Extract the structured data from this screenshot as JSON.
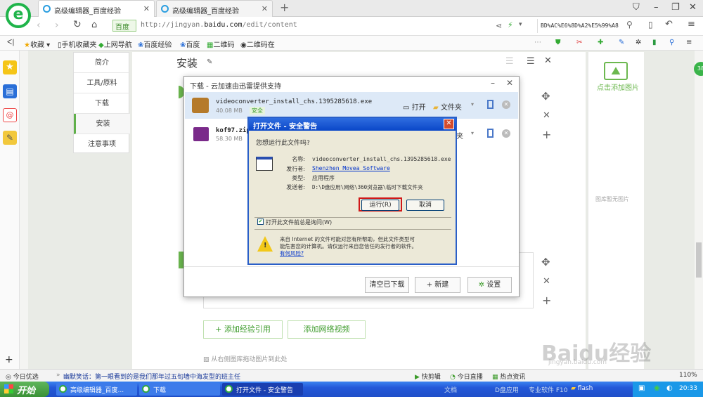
{
  "browser": {
    "tabs": [
      {
        "label": "高级编辑器_百度经验"
      },
      {
        "label": "高级编辑器_百度经验"
      }
    ],
    "new_tab": "+",
    "url_prefix": "http://jingyan.",
    "url_domain": "baidu.com",
    "url_path": "/edit/content",
    "site_badge": "百度",
    "search_text": "BD%AC%E6%8D%A2%E5%99%A8",
    "bookmarks": [
      "收藏",
      "手机收藏夹",
      "上网导航",
      "百度经验",
      "百度",
      "二维码",
      "二维码在"
    ]
  },
  "page": {
    "nav_items": [
      "简介",
      "工具/原料",
      "下载",
      "安装",
      "注意事项"
    ],
    "selected_nav": 3,
    "section_title": "安装",
    "cite_button": "+ 添加经验引用",
    "video_button": "添加网络视频",
    "drag_hint": "从右侧图库拖动图片到此处",
    "right_add_image": "点击添加图片",
    "right_no_image": "图库暂无图片"
  },
  "download_manager": {
    "title": "下载 - 云加速由迅雷提供支持",
    "items": [
      {
        "name": "videoconverter_install_chs.1395285618.exe",
        "size": "40.08 MB",
        "badge": "安全",
        "open": "打开",
        "folder": "文件夹"
      },
      {
        "name": "kof97.zip",
        "size": "58.30 MB",
        "folder": "夹"
      }
    ],
    "clear_btn": "清空已下载",
    "new_btn": "+ 新建",
    "settings_btn": "设置"
  },
  "security_dialog": {
    "title": "打开文件 - 安全警告",
    "question": "您想运行此文件吗?",
    "labels": {
      "name": "名称:",
      "publisher": "发行者:",
      "type": "类型:",
      "from": "发送者:"
    },
    "values": {
      "name": "videoconverter_install_chs.1395285618.exe",
      "publisher": "Shenzhen Movea Software",
      "type": "应用程序",
      "from": "D:\\D盘应用\\网络\\360浏览器\\临时下载文件夹"
    },
    "run_btn": "运行(R)",
    "cancel_btn": "取消",
    "checkbox": "打开此文件前总是询问(W)",
    "warning_line1": "来自 Internet 的文件可能对您有所帮助，但此文件类型可",
    "warning_line2": "能危害您的计算机。请仅运行来自您信任的发行者的软件。",
    "risk_link": "有何风险?"
  },
  "status_bar": {
    "left": "今日优选",
    "ticker": "幽默笑话：第一眼看到的是我们那年过五旬墙中海发型的班主任",
    "items": [
      "快剪辑",
      "今日直播",
      "热点资讯"
    ],
    "zoom": "110%"
  },
  "taskbar": {
    "start": "开始",
    "tasks": [
      "高级编辑器_百度...",
      "下载",
      "打开文件 - 安全警告"
    ],
    "right_items": [
      "文档",
      "D盘应用",
      "专业软件 F10",
      "flash"
    ],
    "time": "20:33"
  },
  "watermark": {
    "brand": "Baidu经验",
    "url": "jingyan.baidu.com"
  },
  "colors": {
    "accent_green": "#60b04a",
    "xp_blue": "#2358d8",
    "logo_green": "#1fb44a"
  }
}
